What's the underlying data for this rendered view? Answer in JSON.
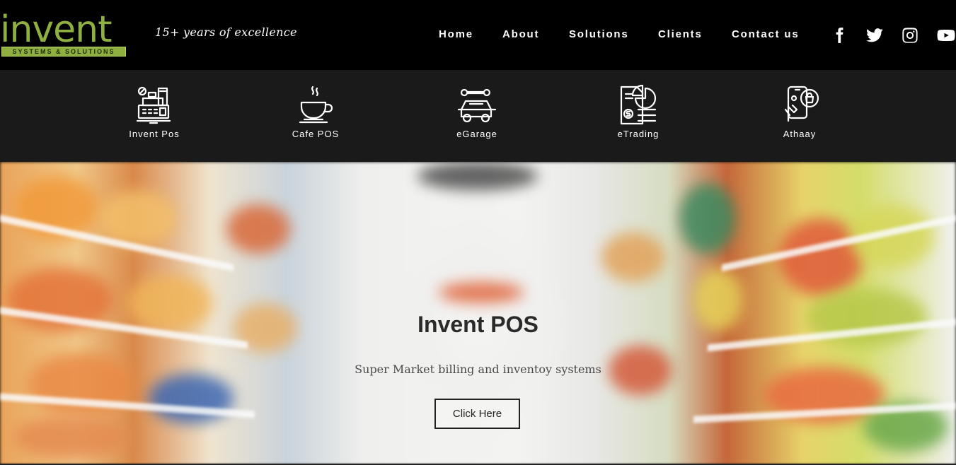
{
  "header": {
    "logo": {
      "word": "invent",
      "subtitle": "SYSTEMS & SOLUTIONS"
    },
    "tagline": "15+ years of excellence",
    "nav": [
      {
        "label": "Home"
      },
      {
        "label": "About"
      },
      {
        "label": "Solutions"
      },
      {
        "label": "Clients"
      },
      {
        "label": "Contact us"
      }
    ],
    "social": [
      "facebook-icon",
      "twitter-icon",
      "instagram-icon",
      "youtube-icon"
    ]
  },
  "products": [
    {
      "label": "Invent Pos",
      "icon": "cash-register-icon"
    },
    {
      "label": "Cafe POS",
      "icon": "coffee-cup-icon"
    },
    {
      "label": "eGarage",
      "icon": "car-wrench-icon"
    },
    {
      "label": "eTrading",
      "icon": "invoice-chart-icon"
    },
    {
      "label": "Athaay",
      "icon": "mobile-shopping-icon"
    }
  ],
  "hero": {
    "title": "Invent POS",
    "subtitle": "Super Market billing and inventoy systems",
    "button_label": "Click Here"
  },
  "colors": {
    "brand_green": "#8fb03e",
    "header_bg": "#000000",
    "product_bar_bg": "#1a1a1a"
  }
}
